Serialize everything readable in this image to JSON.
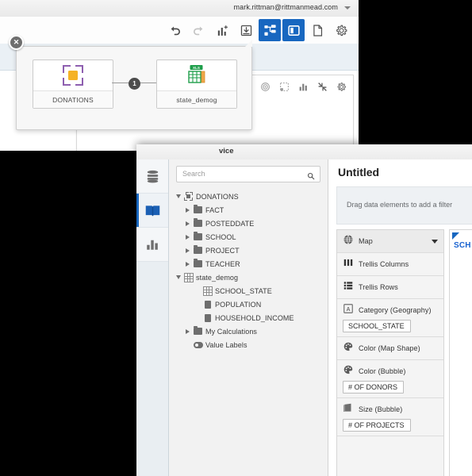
{
  "window_back": {
    "account_bar": {
      "email": "mark.rittman@rittmanmead.com",
      "caret_icon": "chevron-down-icon"
    },
    "toolbar": [
      {
        "name": "undo",
        "icon": "undo-icon",
        "label": "Undo",
        "active": false
      },
      {
        "name": "redo",
        "icon": "redo-icon",
        "label": "Redo",
        "active": false
      },
      {
        "name": "add-viz",
        "icon": "bar-chart-plus-icon",
        "label": "Add Visualization",
        "active": false
      },
      {
        "name": "save",
        "icon": "save-down-icon",
        "label": "Save",
        "active": false
      },
      {
        "name": "data-diagram",
        "icon": "data-flow-icon",
        "label": "Data Diagram",
        "active": true
      },
      {
        "name": "layout-panel",
        "icon": "panel-split-icon",
        "label": "Show Panel",
        "active": true
      },
      {
        "name": "new-page",
        "icon": "page-icon",
        "label": "New Page",
        "active": false
      },
      {
        "name": "settings",
        "icon": "gear-icon",
        "label": "Settings",
        "active": false
      }
    ],
    "canvas_toolbar": [
      {
        "name": "target",
        "icon": "target-icon"
      },
      {
        "name": "marquee-select",
        "icon": "dashed-select-icon"
      },
      {
        "name": "chart",
        "icon": "bar-chart-icon"
      },
      {
        "name": "collapse",
        "icon": "collapse-arrows-icon"
      },
      {
        "name": "settings",
        "icon": "gear-icon"
      }
    ],
    "flow_popup": {
      "close_icon": "close-circle-icon",
      "join_badge": "1",
      "nodes": [
        {
          "label": "DONATIONS",
          "icon": "dataset-brackets-icon"
        },
        {
          "label": "state_demog",
          "icon": "xls-spreadsheet-icon",
          "badge": "XLS"
        }
      ]
    }
  },
  "window_front": {
    "titlebar": {
      "partial_text": "vice"
    },
    "rail": [
      {
        "name": "data-sources",
        "icon": "database-stack-icon",
        "selected": false
      },
      {
        "name": "data-elements",
        "icon": "book-icon",
        "selected": true
      },
      {
        "name": "visualizations",
        "icon": "bar-chart-icon",
        "selected": false
      }
    ],
    "search": {
      "placeholder": "Search",
      "value": "",
      "icon": "search-icon"
    },
    "tree": [
      {
        "label": "DONATIONS",
        "indent": 0,
        "twisty": "down",
        "icon": "dataset-brackets-icon"
      },
      {
        "label": "FACT",
        "indent": 1,
        "twisty": "right",
        "icon": "folder-icon"
      },
      {
        "label": "POSTEDDATE",
        "indent": 1,
        "twisty": "right",
        "icon": "folder-icon"
      },
      {
        "label": "SCHOOL",
        "indent": 1,
        "twisty": "right",
        "icon": "folder-icon"
      },
      {
        "label": "PROJECT",
        "indent": 1,
        "twisty": "right",
        "icon": "folder-icon"
      },
      {
        "label": "TEACHER",
        "indent": 1,
        "twisty": "right",
        "icon": "folder-icon"
      },
      {
        "label": "state_demog",
        "indent": 0,
        "twisty": "down",
        "icon": "table-grid-icon"
      },
      {
        "label": "SCHOOL_STATE",
        "indent": 2,
        "twisty": "none",
        "icon": "attribute-grid-icon"
      },
      {
        "label": "POPULATION",
        "indent": 2,
        "twisty": "none",
        "icon": "measure-icon"
      },
      {
        "label": "HOUSEHOLD_INCOME",
        "indent": 2,
        "twisty": "none",
        "icon": "measure-icon"
      },
      {
        "label": "My Calculations",
        "indent": 1,
        "twisty": "right",
        "icon": "folder-icon"
      },
      {
        "label": "Value Labels",
        "indent": 1,
        "twisty": "none",
        "icon": "value-labels-icon"
      }
    ],
    "project_title": "Untitled",
    "filter_bar": {
      "placeholder": "Drag data elements to add a filter"
    },
    "shelves": [
      {
        "name": "viz-type",
        "label": "Map",
        "icon": "globe-icon",
        "dropdown": true,
        "pills": []
      },
      {
        "name": "trellis-columns",
        "label": "Trellis Columns",
        "icon": "trellis-columns-icon",
        "dropdown": false,
        "pills": []
      },
      {
        "name": "trellis-rows",
        "label": "Trellis Rows",
        "icon": "trellis-rows-icon",
        "dropdown": false,
        "pills": []
      },
      {
        "name": "category-geography",
        "label": "Category (Geography)",
        "icon": "attribute-a-icon",
        "dropdown": false,
        "pills": [
          "SCHOOL_STATE"
        ]
      },
      {
        "name": "color-map-shape",
        "label": "Color (Map Shape)",
        "icon": "palette-icon",
        "dropdown": false,
        "pills": []
      },
      {
        "name": "color-bubble",
        "label": "Color (Bubble)",
        "icon": "palette-icon",
        "dropdown": false,
        "pills": [
          "# OF DONORS"
        ]
      },
      {
        "name": "size-bubble",
        "label": "Size (Bubble)",
        "icon": "measure-bar-icon",
        "dropdown": false,
        "pills": [
          "# OF PROJECTS"
        ]
      }
    ],
    "viz_preview": {
      "marker_icon": "triangle-marker-icon",
      "label": "SCH"
    }
  },
  "colors": {
    "accent_blue": "#1867c0",
    "link_blue": "#1a63d0",
    "purple": "#8e5fb0",
    "orange": "#f5b225",
    "excel_green": "#1e9e4a",
    "red": "#c0392b"
  }
}
